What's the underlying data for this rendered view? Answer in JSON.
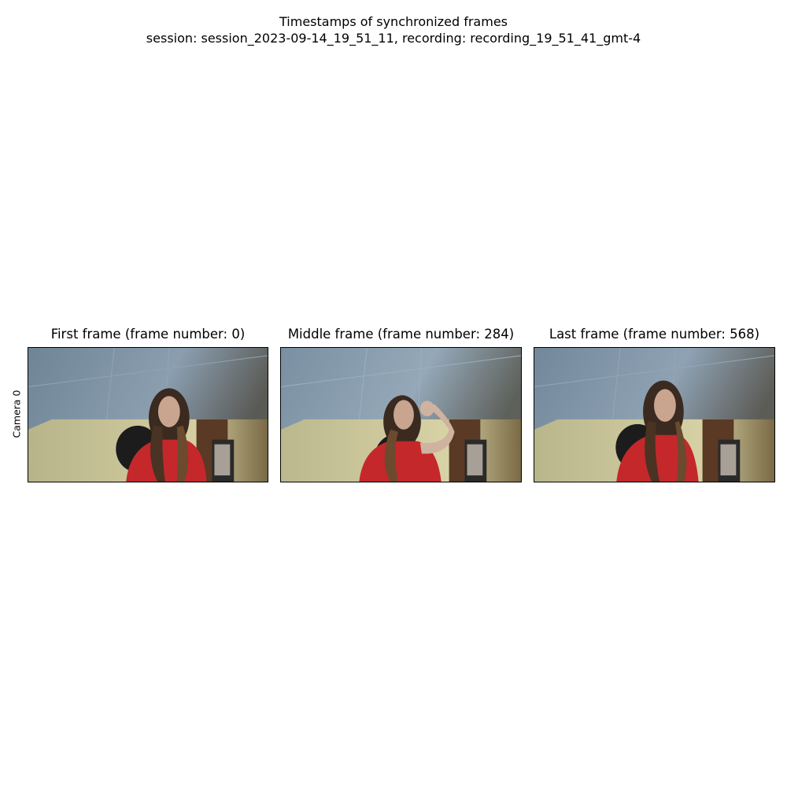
{
  "figure": {
    "title_line1": "Timestamps of synchronized frames",
    "title_line2": "session: session_2023-09-14_19_51_11, recording: recording_19_51_41_gmt-4"
  },
  "row_label": "Camera 0",
  "panels": [
    {
      "title": "First frame (frame number: 0)"
    },
    {
      "title": "Middle frame (frame number: 284)"
    },
    {
      "title": "Last frame (frame number: 568)"
    }
  ],
  "colors": {
    "wall_upper": "#7d93a4",
    "wall_lower": "#c8c49a",
    "shirt": "#c4282b",
    "hair": "#3a2a20",
    "skin": "#c9a590",
    "chair": "#1c1c1c",
    "cabinet": "#5a3a24",
    "keyboard": "#2a2a2a"
  }
}
